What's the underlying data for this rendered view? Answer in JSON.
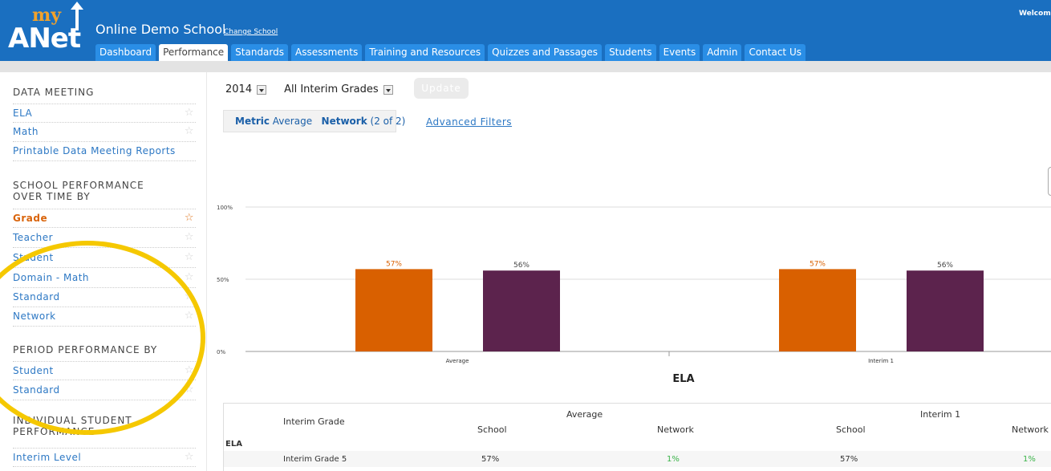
{
  "header": {
    "logo_my": "my",
    "logo_anet": "ANet",
    "school_name": "Online Demo School",
    "change_school": "Change School",
    "welcome": "Welcome",
    "tabs": [
      {
        "label": "Dashboard",
        "active": false
      },
      {
        "label": "Performance",
        "active": true
      },
      {
        "label": "Standards",
        "active": false
      },
      {
        "label": "Assessments",
        "active": false
      },
      {
        "label": "Training and Resources",
        "active": false
      },
      {
        "label": "Quizzes and Passages",
        "active": false
      },
      {
        "label": "Students",
        "active": false
      },
      {
        "label": "Events",
        "active": false
      },
      {
        "label": "Admin",
        "active": false
      },
      {
        "label": "Contact Us",
        "active": false
      }
    ]
  },
  "sidebar": {
    "data_meeting": {
      "title": "DATA MEETING",
      "items": [
        "ELA",
        "Math",
        "Printable Data Meeting Reports"
      ]
    },
    "school_perf": {
      "title_line1": "SCHOOL PERFORMANCE",
      "title_line2": "OVER TIME BY",
      "items": [
        "Grade",
        "Teacher",
        "Student",
        "Domain - Math",
        "Standard",
        "Network"
      ],
      "active": "Grade"
    },
    "period_perf": {
      "title": "PERIOD PERFORMANCE BY",
      "items": [
        "Student",
        "Standard"
      ]
    },
    "individual": {
      "title_line1": "INDIVIDUAL STUDENT",
      "title_line2": "PERFORMANCE",
      "items": [
        "Interim Level"
      ]
    }
  },
  "filters": {
    "year": "2014",
    "grades": "All Interim Grades",
    "update_label": "Update"
  },
  "metric": {
    "metric_label": "Metric",
    "metric_value": "Average",
    "network_label": "Network",
    "network_value": "(2 of 2)",
    "advanced": "Advanced Filters"
  },
  "colors": {
    "school": "#d96000",
    "network": "#5c234d",
    "accent": "#1a6fc0",
    "highlight_circle": "#f5c800"
  },
  "chart_data": {
    "type": "bar",
    "title": "ELA",
    "categories": [
      "Average",
      "Interim 1"
    ],
    "series": [
      {
        "values": [
          57,
          57
        ],
        "labels": [
          "57%",
          "57%"
        ]
      },
      {
        "values": [
          56,
          56
        ],
        "labels": [
          "56%",
          "56%"
        ]
      }
    ],
    "y_ticks": [
      "100%",
      "50%",
      "0%"
    ],
    "ylim": [
      0,
      100
    ],
    "grid": true
  },
  "table": {
    "col_interim_grade": "Interim Grade",
    "group_average": "Average",
    "group_interim1": "Interim 1",
    "col_school": "School",
    "col_network": "Network",
    "subject": "ELA",
    "rows": [
      {
        "name": "Interim Grade 5",
        "avg_school": "57%",
        "avg_network": "1%",
        "i1_school": "57%",
        "i1_network": "1%"
      }
    ]
  }
}
